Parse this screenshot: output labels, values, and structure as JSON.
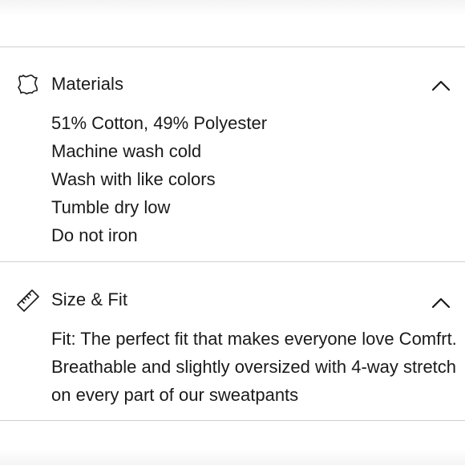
{
  "materials": {
    "title": "Materials",
    "icon": "leather-hide-icon",
    "toggle_icon": "chevron-up-icon",
    "lines": [
      "51% Cotton, 49% Polyester",
      "Machine wash cold",
      "Wash with like colors",
      "Tumble dry low",
      "Do not iron"
    ]
  },
  "size_fit": {
    "title": "Size & Fit",
    "icon": "ruler-icon",
    "toggle_icon": "chevron-up-icon",
    "description": "Fit: The perfect fit that makes everyone love Comfrt. Breathable and slightly oversized with 4-way stretch on every part of our sweatpants"
  }
}
